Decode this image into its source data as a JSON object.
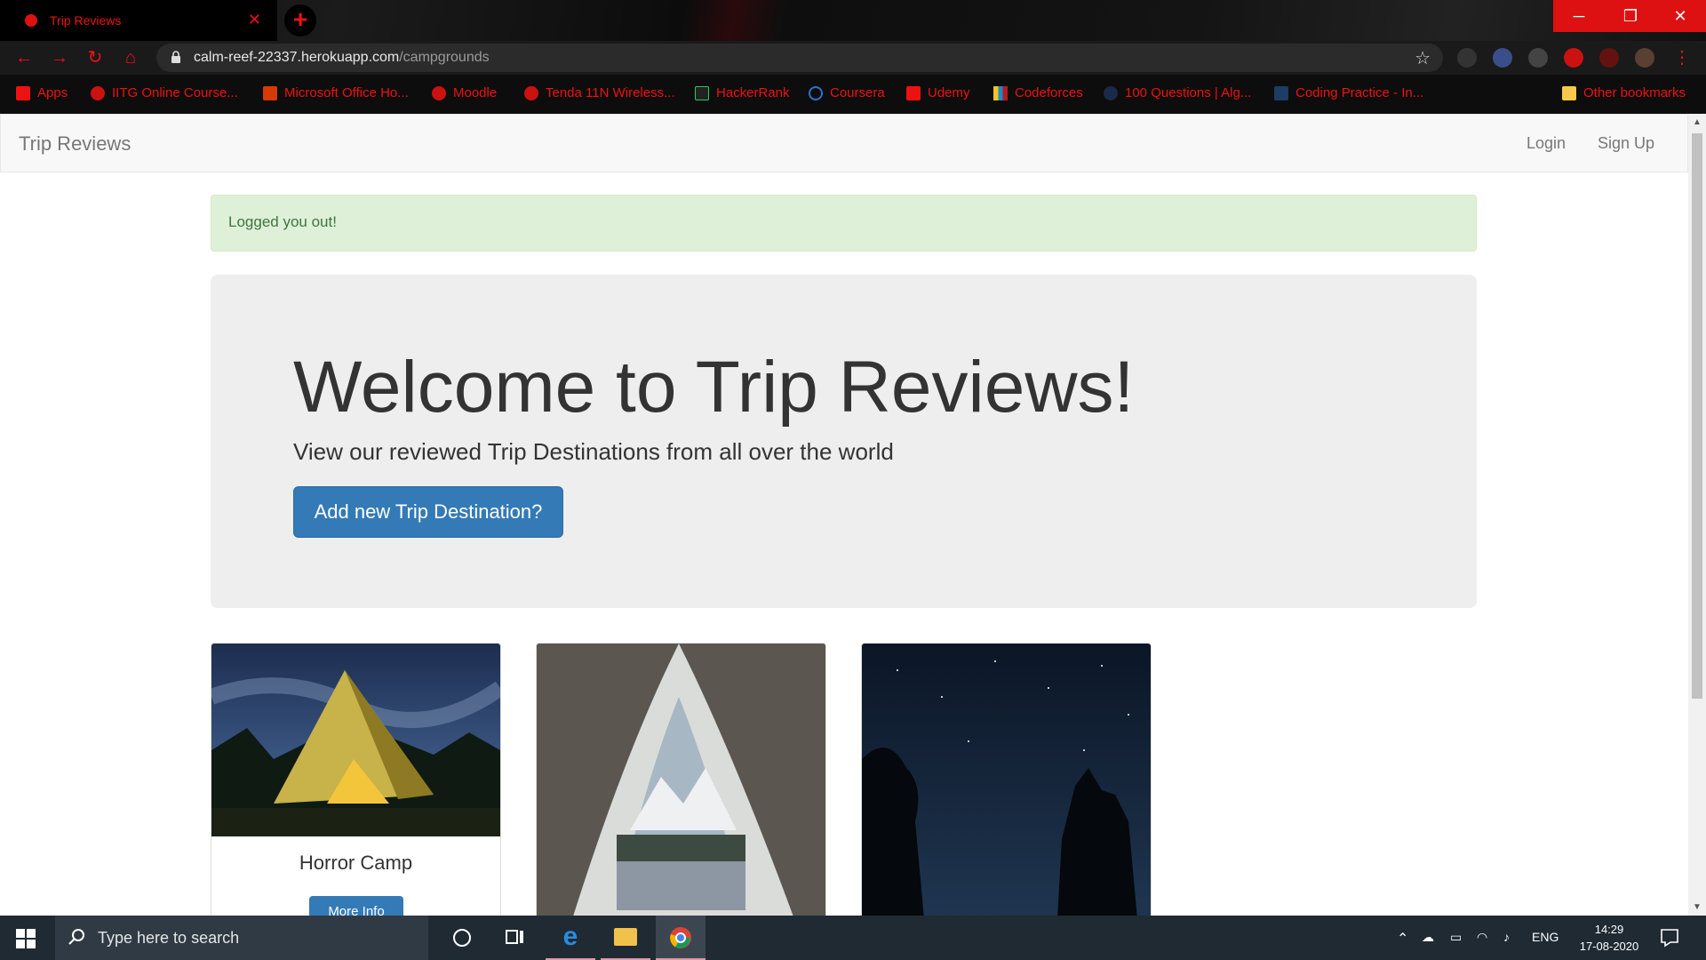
{
  "browser": {
    "tab_title": "Trip Reviews",
    "url_host": "calm-reef-22337.herokuapp.com",
    "url_path": "/campgrounds",
    "bookmarks": [
      "Apps",
      "IITG Online Course...",
      "Microsoft Office Ho...",
      "Moodle",
      "Tenda 11N Wireless...",
      "HackerRank",
      "Coursera",
      "Udemy",
      "Codeforces",
      "100 Questions | Alg...",
      "Coding Practice - In...",
      "Other bookmarks"
    ]
  },
  "navbar": {
    "brand": "Trip Reviews",
    "login": "Login",
    "signup": "Sign Up"
  },
  "alert": {
    "message": "Logged you out!"
  },
  "jumbotron": {
    "heading": "Welcome to Trip Reviews!",
    "subtitle": "View our reviewed Trip Destinations from all over the world",
    "button": "Add new Trip Destination?"
  },
  "destinations": [
    {
      "name": "Horror Camp",
      "button": "More Info"
    },
    {
      "name": "",
      "button": ""
    },
    {
      "name": "",
      "button": ""
    }
  ],
  "taskbar": {
    "search_placeholder": "Type here to search",
    "language": "ENG",
    "time": "14:29",
    "date": "17-08-2020"
  },
  "colors": {
    "primary": "#337ab7",
    "alert_bg": "#dff0d8",
    "alert_text": "#3c763d",
    "jumbotron_bg": "#eeeeee",
    "browser_accent": "#e11111"
  }
}
